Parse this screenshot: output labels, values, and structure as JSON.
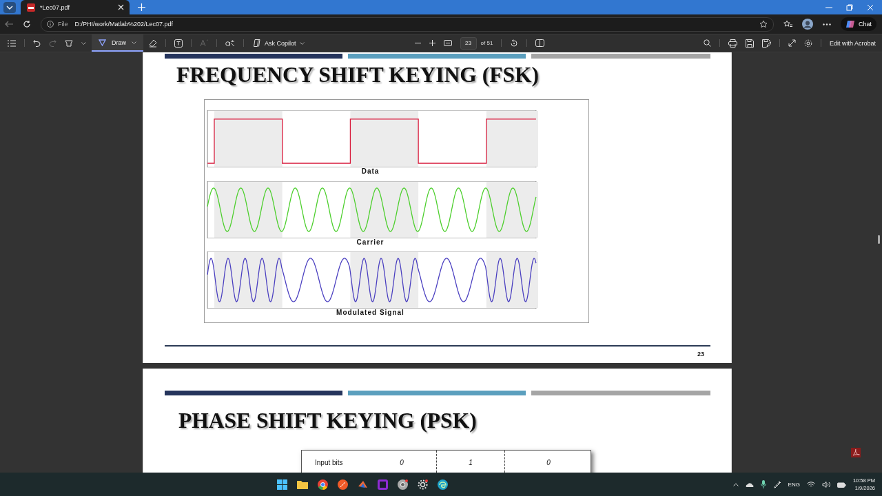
{
  "browser": {
    "tab_title": "*Lec07.pdf",
    "address_label": "File",
    "url": "D:/PHI/work/Matlab%202/Lec07.pdf",
    "chat": "Chat"
  },
  "toolbar": {
    "draw": {
      "label": "Draw",
      "selected": true
    },
    "copilot": "Ask Copilot",
    "page": "23",
    "page_count": "of 51",
    "edit": "Edit with Acrobat"
  },
  "pages": [
    {
      "title": "FREQUENCY SHIFT KEYING (FSK)",
      "figure_labels": [
        "Data",
        "Carrier",
        "Modulated Signal"
      ],
      "page_number": "23"
    },
    {
      "title": "PHASE SHIFT KEYING (PSK)",
      "table_row": [
        "Input bits",
        "0",
        "1",
        "0"
      ]
    }
  ],
  "taskbar": {
    "language": "ENG",
    "time": "10:58 PM",
    "date": "1/9/2026"
  }
}
